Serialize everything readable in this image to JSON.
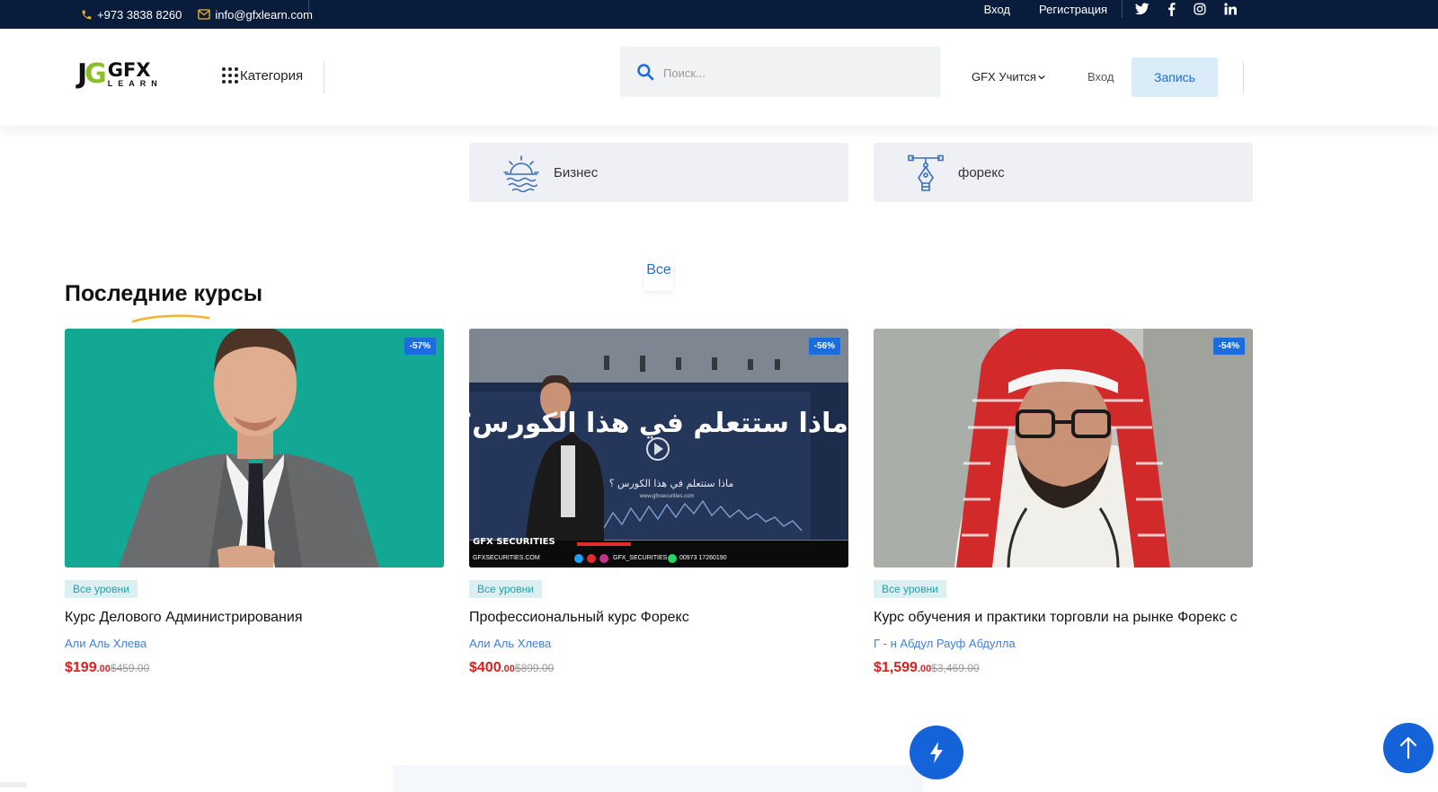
{
  "topbar": {
    "phone": "+973 3838 8260",
    "email": "info@gfxlearn.com",
    "login": "Вход",
    "register": "Регистрация",
    "social_icons": [
      "twitter-icon",
      "facebook-icon",
      "instagram-icon",
      "linkedin-icon"
    ]
  },
  "header": {
    "logo_mark": "JG",
    "logo_name": "GFX",
    "logo_sub": "LEARN",
    "category_label": "Категория",
    "search_placeholder": "Поиск...",
    "nav_gfx": "GFX Учится",
    "nav_login": "Вход",
    "join_button": "Запись"
  },
  "categories": [
    {
      "label": "Бизнес",
      "icon": "sunrise-icon"
    },
    {
      "label": "форекс",
      "icon": "pen-nib-icon"
    }
  ],
  "section": {
    "tab_all": "Все",
    "title": "Последние курсы"
  },
  "courses": [
    {
      "discount": "-57%",
      "level": "Все уровни",
      "title": "Курс Делового Администрирования",
      "author": "Али Аль Хлева",
      "price_main": "$199",
      "price_cents": ".00",
      "old_price": "$459.00"
    },
    {
      "discount": "-56%",
      "level": "Все уровни",
      "title": "Профессиональный курс Форекс",
      "author": "Али Аль Хлева",
      "price_main": "$400",
      "price_cents": ".00",
      "old_price": "$899.00",
      "thumb_headline": "ماذا ستتعلم في هذا الكورس؟",
      "thumb_sub": "ماذا ستتعلم في هذا الكورس ؟",
      "thumb_url": "www.gfxsecurities.com",
      "thumb_brand": "GFX SECURITIES",
      "thumb_footer": "GFXSECURITIES.COM",
      "thumb_handle": "GFX_SECURITIES",
      "thumb_phone": "00973 17260190"
    },
    {
      "discount": "-54%",
      "level": "Все уровни",
      "title": "Курс обучения и практики торговли на рынке Форекс с",
      "author": "Г - н Абдул Рауф Абдулла",
      "price_main": "$1,599",
      "price_cents": ".00",
      "old_price": "$3,469.00"
    }
  ],
  "colors": {
    "topbar_bg": "#0a1c3c",
    "accent_blue": "#1b6cdc",
    "price_red": "#d92020",
    "join_bg": "#d9ecf8"
  }
}
